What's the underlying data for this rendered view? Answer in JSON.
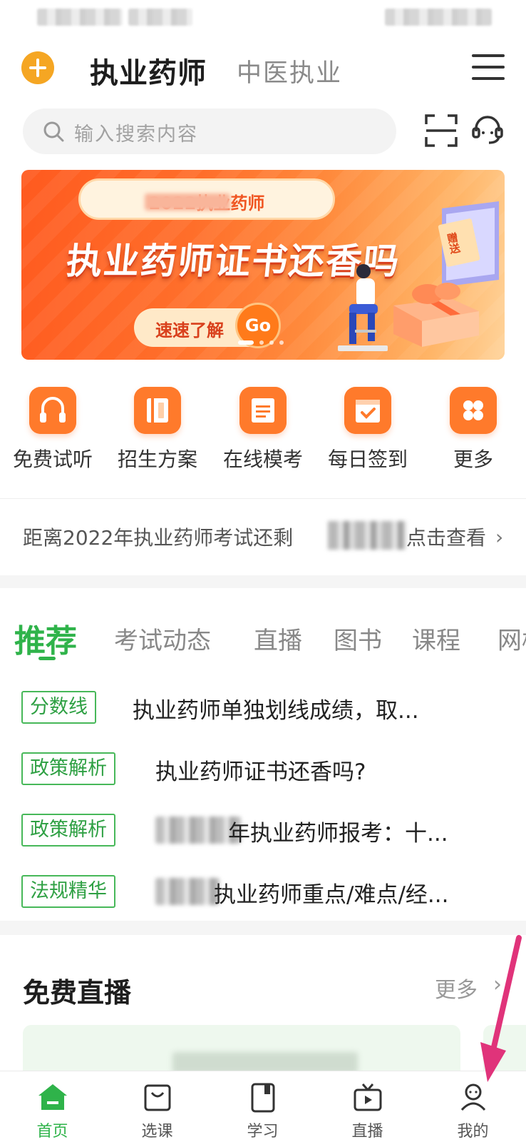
{
  "header": {
    "title": "执业药师",
    "subtitle": "中医执业"
  },
  "search": {
    "placeholder": "输入搜索内容"
  },
  "banner": {
    "pill_text": "2022执业药师",
    "headline": "执业药师证书还香吗",
    "button_label": "速速了解",
    "go_label": "Go",
    "tag_text": "赠送"
  },
  "quick_entries": [
    {
      "label": "免费试听",
      "icon": "headphones-icon"
    },
    {
      "label": "招生方案",
      "icon": "book-icon"
    },
    {
      "label": "在线模考",
      "icon": "document-icon"
    },
    {
      "label": "每日签到",
      "icon": "calendar-check-icon"
    },
    {
      "label": "更多",
      "icon": "grid-icon"
    }
  ],
  "countdown": {
    "prefix": "距离2022年执业药师考试还剩",
    "suffix": "点击查看"
  },
  "tabs": {
    "active": "推荐",
    "items": [
      "考试动态",
      "直播",
      "图书",
      "课程",
      "网校"
    ]
  },
  "news": [
    {
      "tag": "分数线",
      "title": "执业药师单独划线成绩，取..."
    },
    {
      "tag": "政策解析",
      "title": "执业药师证书还香吗?"
    },
    {
      "tag": "政策解析",
      "title": "年执业药师报考：十..."
    },
    {
      "tag": "法规精华",
      "title": "执业药师重点/难点/经..."
    }
  ],
  "live": {
    "title": "免费直播",
    "more": "更多"
  },
  "bottom_nav": [
    {
      "label": "首页",
      "icon": "home-icon",
      "active": true
    },
    {
      "label": "选课",
      "icon": "bag-icon",
      "active": false
    },
    {
      "label": "学习",
      "icon": "notebook-icon",
      "active": false
    },
    {
      "label": "直播",
      "icon": "tv-icon",
      "active": false
    },
    {
      "label": "我的",
      "icon": "user-icon",
      "active": false
    }
  ],
  "colors": {
    "brand_green": "#2fb34a",
    "accent_orange": "#ff6a1f",
    "logo_yellow": "#f5a623",
    "annotation_pink": "#e0337a"
  }
}
